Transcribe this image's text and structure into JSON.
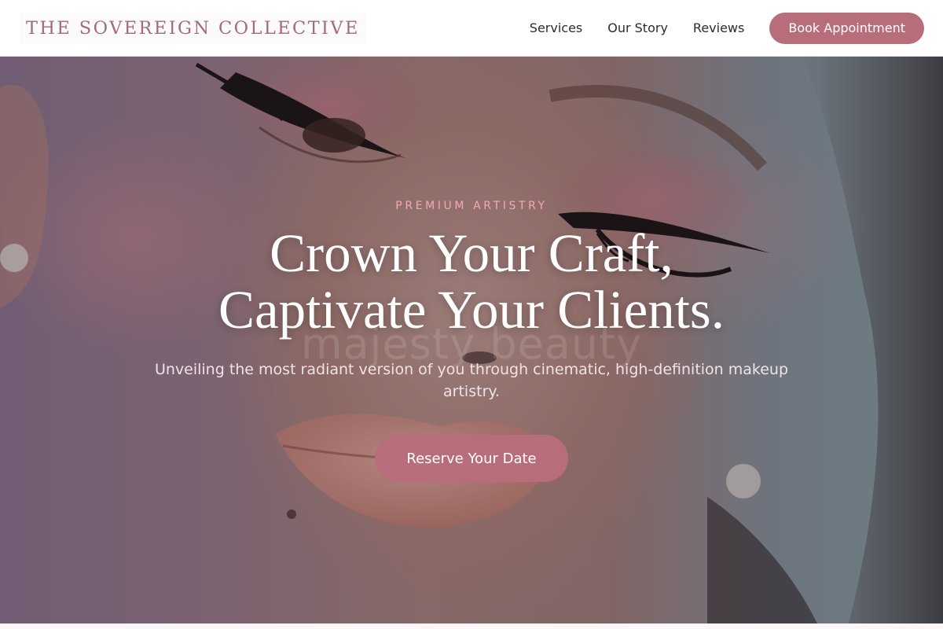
{
  "header": {
    "brand": "THE SOVEREIGN COLLECTIVE",
    "nav": [
      {
        "label": "Services"
      },
      {
        "label": "Our Story"
      },
      {
        "label": "Reviews"
      }
    ],
    "book_button": "Book Appointment"
  },
  "hero": {
    "eyebrow": "PREMIUM ARTISTRY",
    "headline_line1": "Crown Your Craft,",
    "headline_line2": "Captivate Your Clients.",
    "watermark": "majesty beauty",
    "subtext": "Unveiling the most radiant version of you through cinematic, high-definition makeup artistry.",
    "cta": "Reserve Your Date"
  },
  "colors": {
    "accent": "#b76e7a",
    "brand_text": "#a46a79",
    "eyebrow": "#f1a9b3"
  }
}
